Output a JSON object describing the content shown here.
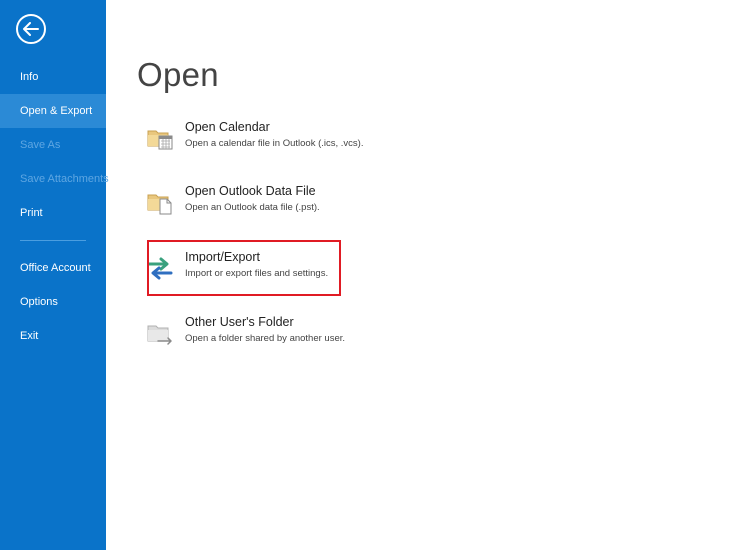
{
  "sidebar": {
    "items": [
      {
        "label": "Info"
      },
      {
        "label": "Open & Export"
      },
      {
        "label": "Save As"
      },
      {
        "label": "Save Attachments"
      },
      {
        "label": "Print"
      },
      {
        "label": "Office Account"
      },
      {
        "label": "Options"
      },
      {
        "label": "Exit"
      }
    ]
  },
  "main": {
    "title": "Open",
    "items": [
      {
        "title": "Open Calendar",
        "description": "Open a calendar file in Outlook (.ics, .vcs).",
        "icon": "calendar-folder-icon"
      },
      {
        "title": "Open Outlook Data File",
        "description": "Open an Outlook data file (.pst).",
        "icon": "data-file-folder-icon"
      },
      {
        "title": "Import/Export",
        "description": "Import or export files and settings.",
        "icon": "import-export-icon"
      },
      {
        "title": "Other User's Folder",
        "description": "Open a folder shared by another user.",
        "icon": "shared-folder-icon"
      }
    ]
  },
  "colors": {
    "sidebar_bg": "#0a73c9",
    "sidebar_selected": "#2b8ad6",
    "highlight_border": "#e01b24"
  }
}
